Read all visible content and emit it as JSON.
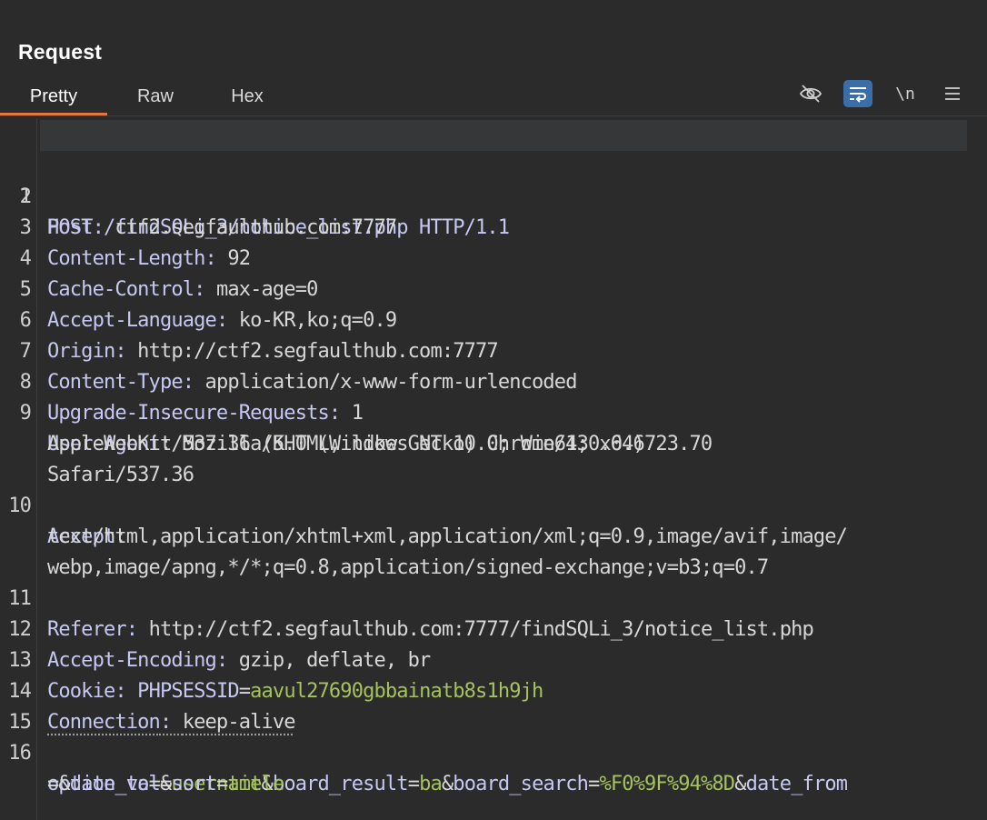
{
  "panel": {
    "title": "Request"
  },
  "tabs": [
    {
      "label": "Pretty",
      "active": true
    },
    {
      "label": "Raw",
      "active": false
    },
    {
      "label": "Hex",
      "active": false
    }
  ],
  "toolbar": {
    "hide_icon": "eye-slash-icon",
    "wrap_icon": "word-wrap-icon",
    "newline_label": "\\n",
    "menu_icon": "menu-icon"
  },
  "colors": {
    "accent": "#e8763b",
    "key": "#c6c8f2",
    "value": "#d7d7d7",
    "string": "#a5c25c",
    "active_tool": "#3a6ea8"
  },
  "lines": [
    {
      "num": "1",
      "request_line": "POST /findSQLi_3/notice_list.php HTTP/1.1"
    },
    {
      "num": "2",
      "key": "Host",
      "value": "ctf2.segfaulthub.com:7777"
    },
    {
      "num": "3",
      "key": "Content-Length",
      "value": "92"
    },
    {
      "num": "4",
      "key": "Cache-Control",
      "value": "max-age=0"
    },
    {
      "num": "5",
      "key": "Accept-Language",
      "value": "ko-KR,ko;q=0.9"
    },
    {
      "num": "6",
      "key": "Origin",
      "value": "http://ctf2.segfaulthub.com:7777"
    },
    {
      "num": "7",
      "key": "Content-Type",
      "value": "application/x-www-form-urlencoded"
    },
    {
      "num": "8",
      "key": "Upgrade-Insecure-Requests",
      "value": "1"
    },
    {
      "num": "9",
      "key": "User-Agent",
      "value": "Mozilla/5.0 (Windows NT 10.0; Win64; x64)",
      "cont1": "AppleWebKit/537.36 (KHTML, like Gecko) Chrome/130.0.6723.70",
      "cont2": "Safari/537.36"
    },
    {
      "num": "10",
      "key": "Accept",
      "cont1": "text/html,application/xhtml+xml,application/xml;q=0.9,image/avif,image/",
      "cont2": "webp,image/apng,*/*;q=0.8,application/signed-exchange;v=b3;q=0.7"
    },
    {
      "num": "11",
      "key": "Referer",
      "value": "http://ctf2.segfaulthub.com:7777/findSQLi_3/notice_list.php"
    },
    {
      "num": "12",
      "key": "Accept-Encoding",
      "value": "gzip, deflate, br"
    },
    {
      "num": "13",
      "key": "Cookie",
      "cookie_name": "PHPSESSID",
      "cookie_value": "aavul27690gbbainatb8s1h9jh"
    },
    {
      "num": "14",
      "key": "Connection",
      "value": "keep-alive"
    },
    {
      "num": "15"
    },
    {
      "num": "16",
      "body": {
        "p1k": "option_val",
        "p1v": "username",
        "p2k": "board_result",
        "p2v": "ba",
        "p3k": "board_search",
        "p3v": "%F0%9F%94%8D",
        "p4k": "date_from",
        "p5k": "date_to",
        "p6k": "sort",
        "p6v": "title"
      }
    }
  ]
}
